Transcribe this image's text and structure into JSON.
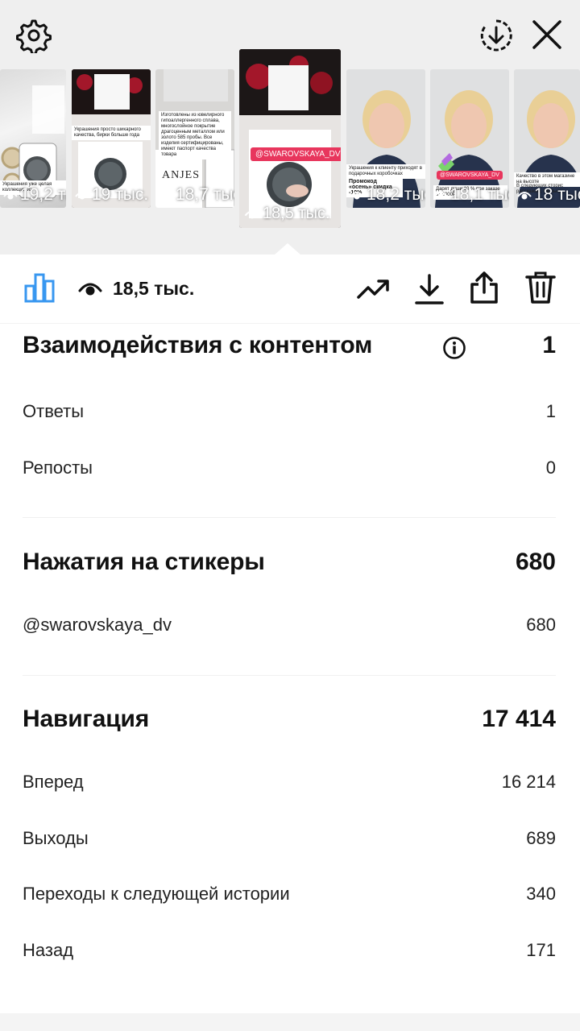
{
  "header": {
    "settings_icon": "gear-icon",
    "download_icon": "circle-download-icon",
    "close_icon": "close-icon"
  },
  "thumbnails": [
    {
      "views": "19,2 тыс.",
      "caption": "Украшения уже целая коллекция из"
    },
    {
      "views": "19 тыс.",
      "caption": "Украшения просто шикарного качества, бирки больше года"
    },
    {
      "views": "18,7 тыс.",
      "caption": "Изготовлены из ювелирного гипоаллергенного сплава, многослойное покрытие драгоценным металлом или золото 585 пробы. Все изделия сертифицированы, имеют паспорт качества товара",
      "brand": "ANJES"
    },
    {
      "views": "18,5 тыс.",
      "tag": "@SWAROVSKAYA_DV",
      "selected": true
    },
    {
      "views": "18,2 тыс.",
      "caption": "Украшения к клиенту приходят в подарочных коробочках",
      "promo": "Промокод «осень» скидка -10%"
    },
    {
      "views": "18,1 тыс.",
      "tag": "@SWAROVSKAYA_DV",
      "caption": "Дарят души 10 % при заказе от 5000Р"
    },
    {
      "views": "18 тыс.",
      "caption": "Качество в этом магазине на высоте",
      "caption2": "В следующих сторис расскажем, сколько"
    }
  ],
  "toolbar": {
    "views_count": "18,5 тыс.",
    "stats_icon": "bar-chart-icon",
    "eye_icon": "eye-icon",
    "trend_icon": "trending-up-icon",
    "download_icon": "download-icon",
    "share_icon": "share-icon",
    "delete_icon": "trash-icon",
    "accent_color": "#3897f0"
  },
  "interactions": {
    "title": "Взаимодействия с контентом",
    "value": "1",
    "rows": [
      {
        "label": "Ответы",
        "value": "1"
      },
      {
        "label": "Репосты",
        "value": "0"
      }
    ]
  },
  "sticker_taps": {
    "title": "Нажатия на стикеры",
    "value": "680",
    "rows": [
      {
        "label": "@swarovskaya_dv",
        "value": "680"
      }
    ]
  },
  "navigation": {
    "title": "Навигация",
    "value": "17 414",
    "rows": [
      {
        "label": "Вперед",
        "value": "16 214"
      },
      {
        "label": "Выходы",
        "value": "689"
      },
      {
        "label": "Переходы к следующей истории",
        "value": "340"
      },
      {
        "label": "Назад",
        "value": "171"
      }
    ]
  }
}
